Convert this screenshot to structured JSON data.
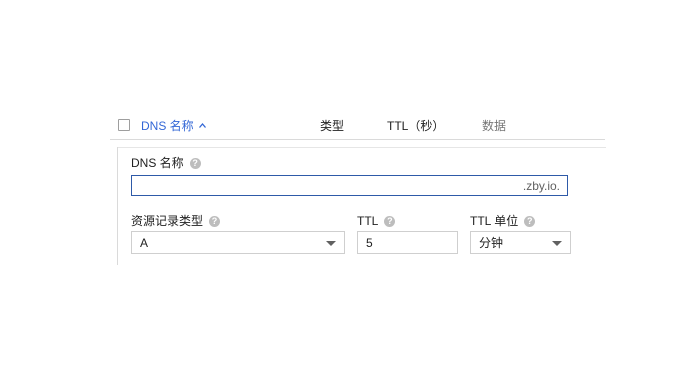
{
  "table_header": {
    "dns_name": "DNS 名称",
    "type": "类型",
    "ttl": "TTL（秒）",
    "data": "数据"
  },
  "form": {
    "dns_name_label": "DNS 名称",
    "dns_name_value": "",
    "dns_suffix": ".zby.io.",
    "record_type_label": "资源记录类型",
    "record_type_value": "A",
    "ttl_label": "TTL",
    "ttl_value": "5",
    "ttl_unit_label": "TTL 单位",
    "ttl_unit_value": "分钟",
    "help_glyph": "?"
  },
  "colors": {
    "accent": "#3367d6",
    "input_border_focused": "#2e5aa8"
  },
  "icons": {
    "sort": "sort-ascending-icon",
    "help": "help-icon",
    "dropdown": "caret-down-icon"
  }
}
